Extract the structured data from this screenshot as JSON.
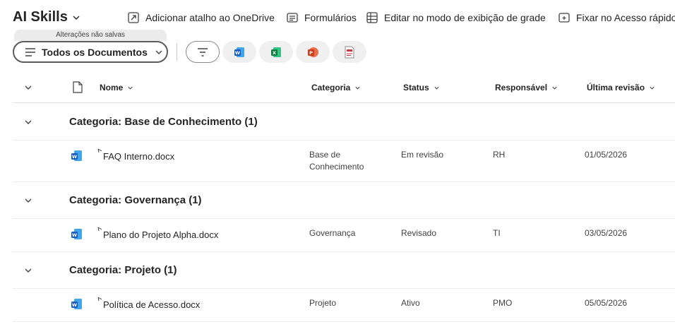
{
  "site": {
    "title": "AI Skills"
  },
  "commands": {
    "onedrive": "Adicionar atalho ao OneDrive",
    "forms": "Formulários",
    "grid": "Editar no modo de exibição de grade",
    "pin": "Fixar no Acesso rápido"
  },
  "view": {
    "unsaved_label": "Alterações não salvas",
    "name": "Todos os Documentos"
  },
  "columns": {
    "name": "Nome",
    "category": "Categoria",
    "status": "Status",
    "owner": "Responsável",
    "last_review": "Última revisão"
  },
  "groups": [
    {
      "title": "Categoria: Base de Conhecimento (1)",
      "item": {
        "name": "FAQ Interno.docx",
        "category_line1": "Base de",
        "category_line2": "Conhecimento",
        "status": "Em revisão",
        "owner": "RH",
        "last_review": "01/05/2026"
      }
    },
    {
      "title": "Categoria: Governança (1)",
      "item": {
        "name": "Plano do Projeto Alpha.docx",
        "category": "Governança",
        "status": "Revisado",
        "owner": "TI",
        "last_review": "03/05/2026"
      }
    },
    {
      "title": "Categoria: Projeto (1)",
      "item": {
        "name": "Política de Acesso.docx",
        "category": "Projeto",
        "status": "Ativo",
        "owner": "PMO",
        "last_review": "05/05/2026"
      }
    }
  ],
  "icons": {
    "word": "word-icon",
    "excel": "excel-icon",
    "powerpoint": "powerpoint-icon",
    "pdf": "pdf-icon",
    "filter": "filter-icon"
  },
  "colors": {
    "word": "#185abd",
    "excel": "#107c41",
    "powerpoint": "#c43e1c",
    "pdf": "#d13438"
  }
}
